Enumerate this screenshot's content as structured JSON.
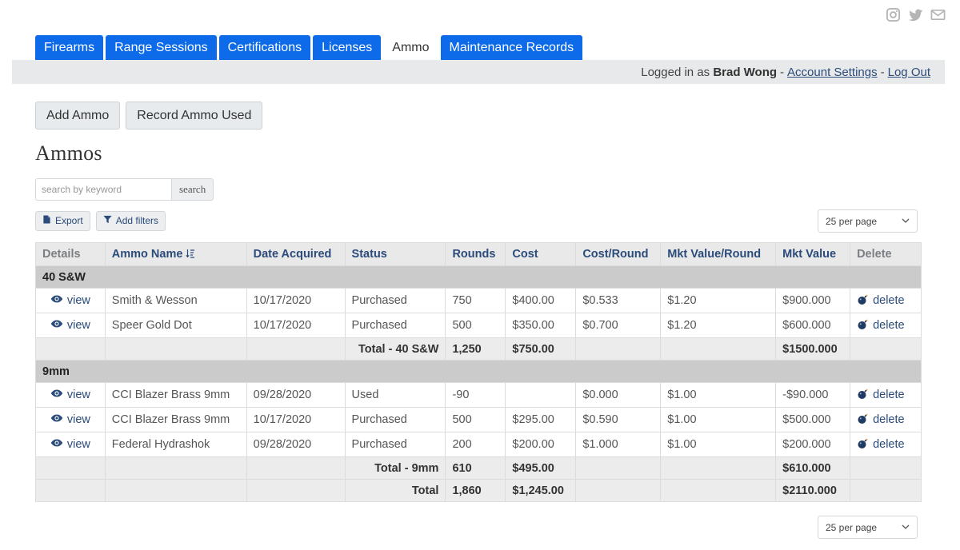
{
  "tabs": [
    {
      "label": "Firearms"
    },
    {
      "label": "Range Sessions"
    },
    {
      "label": "Certifications"
    },
    {
      "label": "Licenses"
    },
    {
      "label": "Ammo",
      "active": true
    },
    {
      "label": "Maintenance Records"
    }
  ],
  "userbar": {
    "prefix": "Logged in as",
    "user": "Brad Wong",
    "separator": "-",
    "account_settings": "Account Settings",
    "logout": "Log Out"
  },
  "actions": {
    "add": "Add Ammo",
    "record": "Record Ammo Used"
  },
  "page_title": "Ammos",
  "search": {
    "placeholder": "search by keyword",
    "value": "",
    "button": "search"
  },
  "tools": {
    "export": "Export",
    "filters": "Add filters"
  },
  "per_page": "25 per page",
  "columns": [
    "Details",
    "Ammo Name",
    "Date Acquired",
    "Status",
    "Rounds",
    "Cost",
    "Cost/Round",
    "Mkt Value/Round",
    "Mkt Value",
    "Delete"
  ],
  "link_labels": {
    "view": "view",
    "delete": "delete"
  },
  "groups": [
    {
      "name": "40 S&W",
      "rows": [
        {
          "name": "Smith & Wesson",
          "date": "10/17/2020",
          "status": "Purchased",
          "rounds": "750",
          "cost": "$400.00",
          "cost_round": "$0.533",
          "mkt_round": "$1.20",
          "mkt_value": "$900.000"
        },
        {
          "name": "Speer Gold Dot",
          "date": "10/17/2020",
          "status": "Purchased",
          "rounds": "500",
          "cost": "$350.00",
          "cost_round": "$0.700",
          "mkt_round": "$1.20",
          "mkt_value": "$600.000"
        }
      ],
      "total": {
        "label": "Total - 40 S&W",
        "rounds": "1,250",
        "cost": "$750.00",
        "mkt_value": "$1500.000"
      }
    },
    {
      "name": "9mm",
      "rows": [
        {
          "name": "CCI Blazer Brass 9mm",
          "date": "09/28/2020",
          "status": "Used",
          "rounds": "-90",
          "cost": "",
          "cost_round": "$0.000",
          "mkt_round": "$1.00",
          "mkt_value": "-$90.000"
        },
        {
          "name": "CCI Blazer Brass 9mm",
          "date": "10/17/2020",
          "status": "Purchased",
          "rounds": "500",
          "cost": "$295.00",
          "cost_round": "$0.590",
          "mkt_round": "$1.00",
          "mkt_value": "$500.000"
        },
        {
          "name": "Federal Hydrashok",
          "date": "09/28/2020",
          "status": "Purchased",
          "rounds": "200",
          "cost": "$200.00",
          "cost_round": "$1.000",
          "mkt_round": "$1.00",
          "mkt_value": "$200.000"
        }
      ],
      "total": {
        "label": "Total - 9mm",
        "rounds": "610",
        "cost": "$495.00",
        "mkt_value": "$610.000"
      }
    }
  ],
  "grand_total": {
    "label": "Total",
    "rounds": "1,860",
    "cost": "$1,245.00",
    "mkt_value": "$2110.000"
  },
  "icons": {
    "social": [
      "instagram-icon",
      "twitter-icon",
      "mail-icon"
    ],
    "view": "eye-icon",
    "delete": "bomb-icon",
    "export": "file-icon",
    "filters": "funnel-icon",
    "sort": "sort-alpha-icon",
    "select": "chevron-down-icon"
  },
  "colors": {
    "tab": "#0d6ae8",
    "link": "#2b4b7a",
    "group_row": "#cbcbcb",
    "header_row": "#e9e9e9"
  }
}
